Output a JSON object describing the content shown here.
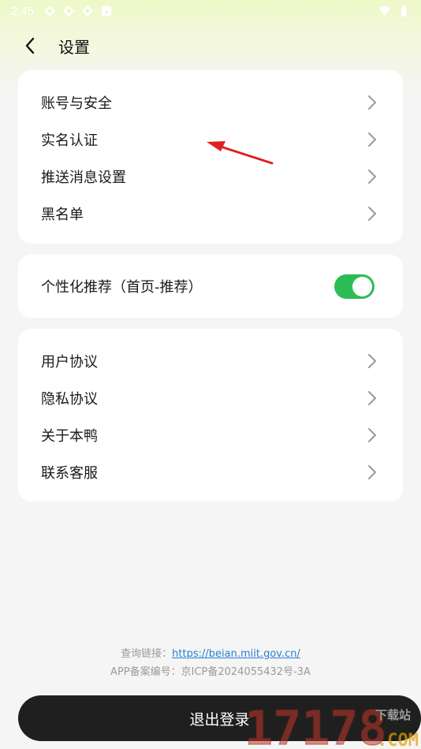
{
  "status_bar": {
    "time": "2:45"
  },
  "header": {
    "title": "设置"
  },
  "card_account": {
    "items": [
      {
        "label": "账号与安全"
      },
      {
        "label": "实名认证"
      },
      {
        "label": "推送消息设置"
      },
      {
        "label": "黑名单"
      }
    ]
  },
  "card_recommend": {
    "label": "个性化推荐（首页-推荐）",
    "enabled": true
  },
  "card_about": {
    "items": [
      {
        "label": "用户协议"
      },
      {
        "label": "隐私协议"
      },
      {
        "label": "关于本鸭"
      },
      {
        "label": "联系客服"
      }
    ]
  },
  "footer": {
    "query_prefix": "查询链接：",
    "query_url": "https://beian.miit.gov.cn/",
    "icp": "APP备案编号：京ICP备2024055432号-3A"
  },
  "logout": {
    "label": "退出登录"
  },
  "watermark": {
    "brand": "下载站",
    "number": "17178",
    "domain": ".COM"
  },
  "colors": {
    "toggle_on": "#2bbd55",
    "link": "#2a7fd6",
    "annotation": "#e02020",
    "button_bg": "#1f1f1f"
  }
}
